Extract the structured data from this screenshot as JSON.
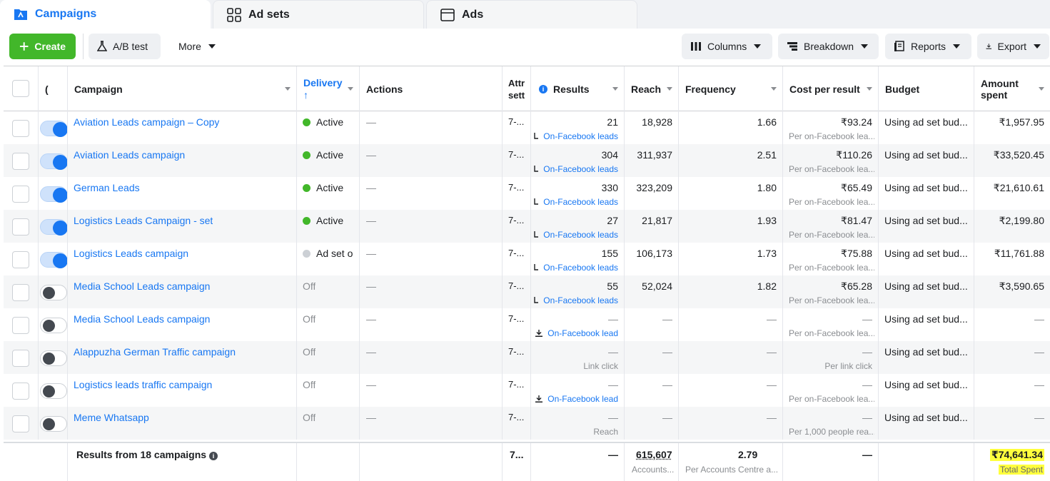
{
  "tabs": [
    {
      "label": "Campaigns",
      "icon": "campaigns-icon"
    },
    {
      "label": "Ad sets",
      "icon": "adsets-grid-icon"
    },
    {
      "label": "Ads",
      "icon": "ads-window-icon"
    }
  ],
  "toolbar": {
    "create_label": "Create",
    "ab_test_label": "A/B test",
    "more_label": "More",
    "columns_label": "Columns",
    "breakdown_label": "Breakdown",
    "reports_label": "Reports",
    "export_label": "Export"
  },
  "columns": {
    "status_short": "(",
    "campaign": "Campaign",
    "delivery": "Delivery",
    "delivery_arrow": "↑",
    "actions": "Actions",
    "attr": "Attr",
    "attr2": "sett",
    "results": "Results",
    "reach": "Reach",
    "frequency": "Frequency",
    "cost_per_result": "Cost per result",
    "budget": "Budget",
    "amount_spent_1": "Amount",
    "amount_spent_2": "spent"
  },
  "rows": [
    {
      "name": "Aviation Leads campaign – Copy",
      "toggle": "on",
      "delivery": "Active",
      "delivery_status": "active",
      "actions": "—",
      "attr": "7-...",
      "results": "21",
      "results_sub": "On-Facebook leads",
      "reach": "18,928",
      "frequency": "1.66",
      "cost": "₹93.24",
      "cost_sub": "Per on-Facebook lea...",
      "budget": "Using ad set bud...",
      "spent": "₹1,957.95"
    },
    {
      "name": "Aviation Leads campaign",
      "toggle": "on",
      "delivery": "Active",
      "delivery_status": "active",
      "actions": "—",
      "attr": "7-...",
      "results": "304",
      "results_sub": "On-Facebook leads",
      "reach": "311,937",
      "frequency": "2.51",
      "cost": "₹110.26",
      "cost_sub": "Per on-Facebook lea...",
      "budget": "Using ad set bud...",
      "spent": "₹33,520.45"
    },
    {
      "name": "German Leads",
      "toggle": "on",
      "delivery": "Active",
      "delivery_status": "active",
      "actions": "—",
      "attr": "7-...",
      "results": "330",
      "results_sub": "On-Facebook leads",
      "reach": "323,209",
      "frequency": "1.80",
      "cost": "₹65.49",
      "cost_sub": "Per on-Facebook lea...",
      "budget": "Using ad set bud...",
      "spent": "₹21,610.61"
    },
    {
      "name": "Logistics Leads Campaign - set",
      "toggle": "on",
      "delivery": "Active",
      "delivery_status": "active",
      "actions": "—",
      "attr": "7-...",
      "results": "27",
      "results_sub": "On-Facebook leads",
      "reach": "21,817",
      "frequency": "1.93",
      "cost": "₹81.47",
      "cost_sub": "Per on-Facebook lea...",
      "budget": "Using ad set bud...",
      "spent": "₹2,199.80"
    },
    {
      "name": "Logistics Leads campaign",
      "toggle": "on",
      "delivery": "Ad set o",
      "delivery_status": "adset-off",
      "actions": "—",
      "attr": "7-...",
      "results": "155",
      "results_sub": "On-Facebook leads",
      "reach": "106,173",
      "frequency": "1.73",
      "cost": "₹75.88",
      "cost_sub": "Per on-Facebook lea...",
      "budget": "Using ad set bud...",
      "spent": "₹11,761.88"
    },
    {
      "name": "Media School Leads campaign",
      "toggle": "off",
      "delivery": "Off",
      "delivery_status": "off",
      "actions": "—",
      "attr": "7-...",
      "results": "55",
      "results_sub": "On-Facebook leads",
      "reach": "52,024",
      "frequency": "1.82",
      "cost": "₹65.28",
      "cost_sub": "Per on-Facebook lea...",
      "budget": "Using ad set bud...",
      "spent": "₹3,590.65"
    },
    {
      "name": "Media School Leads campaign",
      "toggle": "off",
      "delivery": "Off",
      "delivery_status": "off",
      "actions": "—",
      "attr": "7-...",
      "results": "—",
      "results_sub": "On-Facebook lead",
      "reach": "—",
      "frequency": "—",
      "cost": "—",
      "cost_sub": "Per on-Facebook lea...",
      "budget": "Using ad set bud...",
      "spent": "—"
    },
    {
      "name": "Alappuzha German Traffic campaign",
      "toggle": "off",
      "delivery": "Off",
      "delivery_status": "off",
      "actions": "—",
      "attr": "7-...",
      "results": "—",
      "results_sub": "Link click",
      "reach": "—",
      "frequency": "—",
      "cost": "—",
      "cost_sub": "Per link click",
      "budget": "Using ad set bud...",
      "spent": "—"
    },
    {
      "name": "Logistics leads traffic campaign",
      "toggle": "off",
      "delivery": "Off",
      "delivery_status": "off",
      "actions": "—",
      "attr": "7-...",
      "results": "—",
      "results_sub": "On-Facebook lead",
      "reach": "—",
      "frequency": "—",
      "cost": "—",
      "cost_sub": "Per on-Facebook lea...",
      "budget": "Using ad set bud...",
      "spent": "—"
    },
    {
      "name": "Meme Whatsapp",
      "toggle": "off",
      "delivery": "Off",
      "delivery_status": "off",
      "actions": "—",
      "attr": "7-...",
      "results": "—",
      "results_sub": "Reach",
      "reach": "—",
      "frequency": "—",
      "cost": "—",
      "cost_sub": "Per 1,000 people rea...",
      "budget": "Using ad set bud...",
      "spent": "—"
    }
  ],
  "footer": {
    "label": "Results from 18 campaigns",
    "attr": "7...",
    "results": "—",
    "reach": "615,607",
    "reach_sub": "Accounts...",
    "frequency": "2.79",
    "frequency_sub": "Per Accounts Centre a...",
    "cost": "—",
    "spent": "₹74,641.34",
    "spent_sub": "Total Spent"
  },
  "colors": {
    "accent": "#1877f2",
    "create_green": "#42b72a",
    "active_dot": "#42b72a",
    "highlight": "#ffff3d"
  }
}
